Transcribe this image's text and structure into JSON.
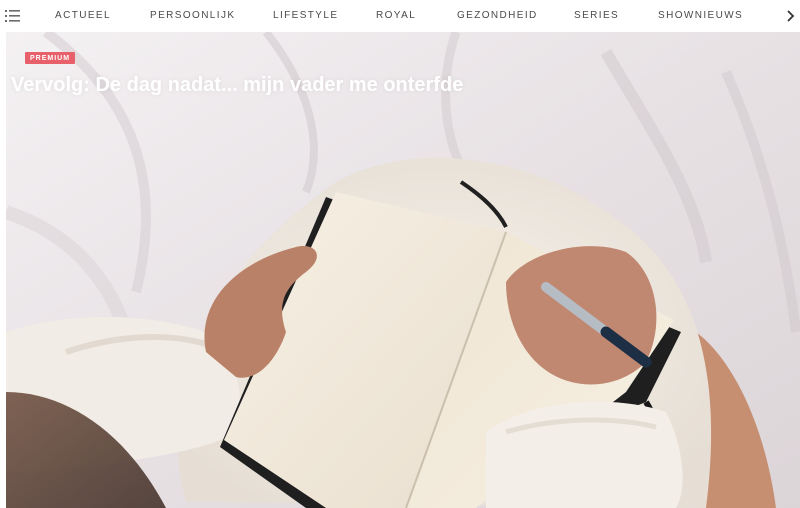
{
  "nav": {
    "items": [
      "ACTUEEL",
      "PERSOONLIJK",
      "LIFESTYLE",
      "ROYAL",
      "GEZONDHEID",
      "SERIES",
      "SHOWNIEUWS"
    ],
    "menu_icon": "hamburger-list-icon",
    "next_icon": "chevron-right-icon"
  },
  "article": {
    "badge": "PREMIUM",
    "title": "Vervolg: De dag nadat... mijn vader me onterfde"
  },
  "colors": {
    "badge": "#e8606a",
    "nav_text": "#4a4a4a",
    "headline": "#ffffff"
  }
}
